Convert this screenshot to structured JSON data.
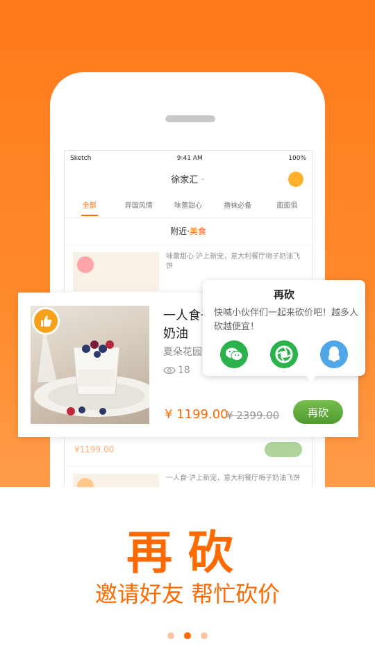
{
  "status": {
    "carrier": "Sketch",
    "time": "9:41 AM",
    "battery": "100%"
  },
  "nav": {
    "title": "徐家汇"
  },
  "tabs": [
    "全部",
    "异国风情",
    "味蕾甜心",
    "撸袜必备",
    "面面俱"
  ],
  "nearby": {
    "prefix": "附近·",
    "category": "美食"
  },
  "bg_items": [
    {
      "title": "味蕾甜心·沪上新宠，意大利餐厅梅子奶油飞饼"
    },
    {
      "title": "一人食·沪上新宠，意大利餐厅梅子奶油飞饼"
    }
  ],
  "bg_mid_price": "¥1199.00",
  "card": {
    "title": "一人食子奶油",
    "shop": "夏朵花园",
    "views": "18",
    "price": "¥ 1199.00",
    "orig_price": "¥ 2399.00",
    "button": "再砍"
  },
  "popup": {
    "title": "再砍",
    "desc": "快喊小伙伴们一起来砍价吧！越多人砍越便宜！",
    "share": [
      {
        "icon": "wechat-icon",
        "color": "#2bb24c"
      },
      {
        "icon": "moments-icon",
        "color": "#2bb24c"
      },
      {
        "icon": "qq-icon",
        "color": "#4fa7e8"
      }
    ]
  },
  "banner": {
    "title": "再砍",
    "subtitle": "邀请好友 帮忙砍价"
  },
  "pager": {
    "count": 3,
    "active": 1
  },
  "colors": {
    "accent": "#ff6a00",
    "green": "#5aa53a",
    "bg_top": "#ff7a1a"
  }
}
